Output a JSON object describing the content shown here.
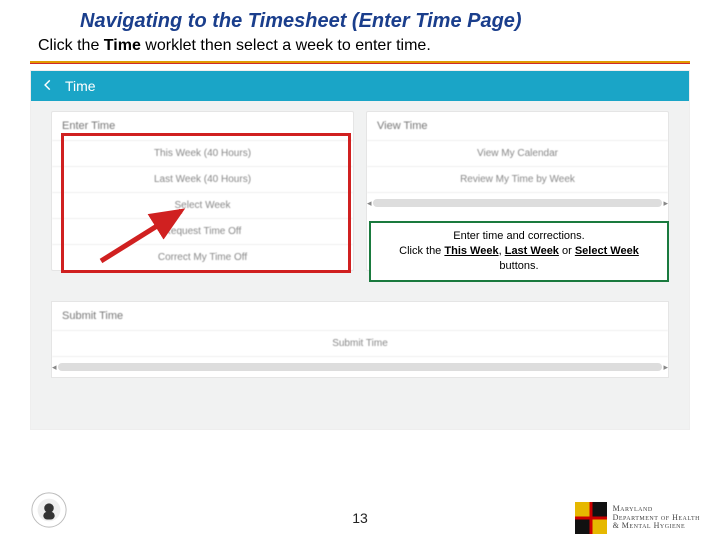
{
  "title": "Navigating to the Timesheet (Enter Time Page)",
  "instruction_pre": "Click the ",
  "instruction_bold": "Time",
  "instruction_post": " worklet then select a week to enter time.",
  "topbar": {
    "back": "←",
    "label": "Time"
  },
  "panels": {
    "enter": {
      "header": "Enter Time",
      "rows": [
        "This Week (40 Hours)",
        "Last Week (40 Hours)",
        "Select Week",
        "Request Time Off",
        "Correct My Time Off"
      ]
    },
    "view": {
      "header": "View Time",
      "rows": [
        "View My Calendar",
        "Review My Time by Week"
      ]
    },
    "submit": {
      "header": "Submit Time",
      "rows": [
        "Submit Time"
      ]
    }
  },
  "callout": {
    "line1": "Enter time and corrections.",
    "line2a": "Click the ",
    "b1": "This Week",
    "sep1": ", ",
    "b2": "Last Week",
    "sep2": " or ",
    "b3": "Select Week",
    "line2b": " buttons."
  },
  "page_number": "13",
  "dept": {
    "l1": "Maryland",
    "l2": "Department of Health",
    "l3": "& Mental Hygiene"
  }
}
